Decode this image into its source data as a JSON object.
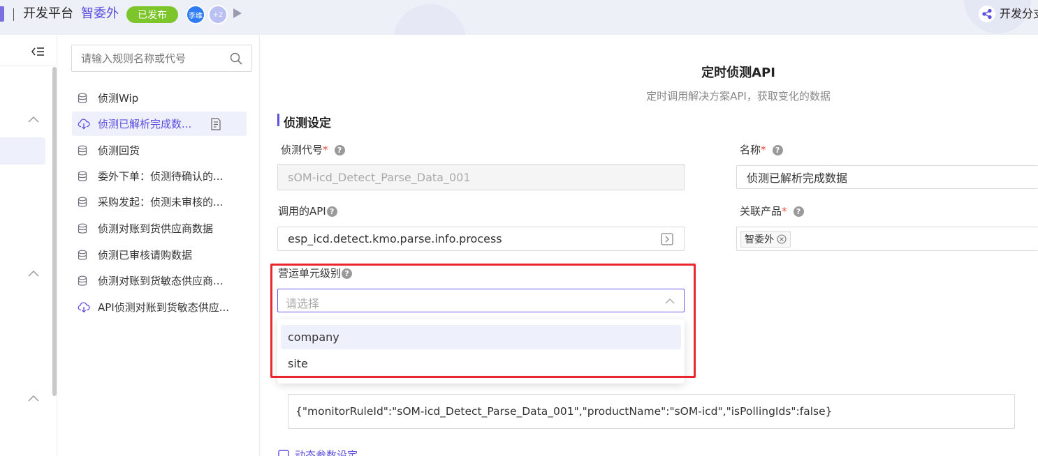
{
  "header": {
    "brand_partial": "",
    "platform": "开发平台",
    "app_name": "智委外",
    "status_badge": "已发布",
    "avatar_user": "李维",
    "avatar_more": "+2",
    "right_link": "开发分支",
    "colors": {
      "accent": "#5b4ee0",
      "badge": "#7cc52a",
      "avatar": "#2f7cf6"
    }
  },
  "search": {
    "placeholder": "请输入规则名称或代号"
  },
  "rules": [
    {
      "label": "侦测Wip",
      "icon": "database-icon",
      "active": false
    },
    {
      "label": "侦测已解析完成数...",
      "icon": "cloud-download-icon",
      "active": true
    },
    {
      "label": "侦测回货",
      "icon": "database-icon",
      "active": false
    },
    {
      "label": "委外下单：侦测待确认的...",
      "icon": "database-icon",
      "active": false
    },
    {
      "label": "采购发起：侦测未审核的...",
      "icon": "database-icon",
      "active": false
    },
    {
      "label": "侦测对账到货供应商数据",
      "icon": "database-icon",
      "active": false
    },
    {
      "label": "侦测已审核请购数据",
      "icon": "database-icon",
      "active": false
    },
    {
      "label": "侦测对账到货敏态供应商...",
      "icon": "database-icon",
      "active": false
    },
    {
      "label": "API侦测对账到货敏态供应...",
      "icon": "cloud-download-icon",
      "active": false
    }
  ],
  "form": {
    "title": "定时侦测API",
    "subtitle": "定时调用解决方案API，获取变化的数据",
    "section": "侦测设定",
    "detect_code": {
      "label": "侦测代号",
      "value": "sOM-icd_Detect_Parse_Data_001"
    },
    "name": {
      "label": "名称",
      "value": "侦测已解析完成数据"
    },
    "api": {
      "label": "调用的API",
      "value": "esp_icd.detect.kmo.parse.info.process"
    },
    "product": {
      "label": "关联产品",
      "tag": "智委外"
    },
    "op_unit": {
      "label": "营运单元级别",
      "placeholder": "请选择",
      "options": [
        "company",
        "site"
      ]
    },
    "params": {
      "value": "{\"monitorRuleId\":\"sOM-icd_Detect_Parse_Data_001\",\"productName\":\"sOM-icd\",\"isPollingIds\":false}"
    },
    "dynamic_params": "动态参数设定",
    "required_mark": "*",
    "help_mark": "?"
  }
}
